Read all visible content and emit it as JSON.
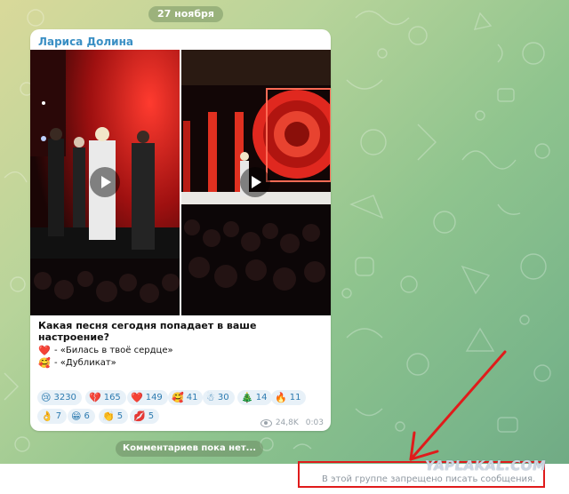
{
  "chat": {
    "date_label": "27 ноября"
  },
  "post": {
    "author": "Лариса Долина",
    "question": "Какая песня сегодня попадает в ваше настроение?",
    "options": [
      {
        "icon": "red-heart-emoji",
        "emoji": "❤️",
        "text": "- «Билась в твоё сердце»"
      },
      {
        "icon": "smiling-face-with-hearts-emoji",
        "emoji": "🥰",
        "text": "- «Дубликат»"
      }
    ],
    "reactions": [
      {
        "icon": "sad-face-emoji",
        "emoji": "😢",
        "count": "3230"
      },
      {
        "icon": "broken-heart-emoji",
        "emoji": "💔",
        "count": "165"
      },
      {
        "icon": "red-heart-emoji",
        "emoji": "❤️",
        "count": "149"
      },
      {
        "icon": "smiling-face-with-hearts-emoji",
        "emoji": "🥰",
        "count": "41"
      },
      {
        "icon": "snowman-emoji",
        "emoji": "☃",
        "count": "30"
      },
      {
        "icon": "christmas-tree-emoji",
        "emoji": "🎄",
        "count": "14"
      },
      {
        "icon": "fire-emoji",
        "emoji": "🔥",
        "count": "11"
      },
      {
        "icon": "ok-hand-emoji",
        "emoji": "👌",
        "count": "7"
      },
      {
        "icon": "grinning-face-emoji",
        "emoji": "😁",
        "count": "6"
      },
      {
        "icon": "clapping-hands-emoji",
        "emoji": "👏",
        "count": "5"
      },
      {
        "icon": "kiss-lips-emoji",
        "emoji": "💋",
        "count": "5"
      }
    ],
    "views": "24,8K",
    "time": "0:03"
  },
  "comments_label": "Комментариев пока нет...",
  "input": {
    "readonly_text": "В этой группе запрещено писать сообщения."
  },
  "watermark": "YAPLAKAL.COM",
  "colors": {
    "annotation_red": "#e01b1b",
    "author_blue": "#3a8fc4",
    "reaction_bg": "#e8f1f8"
  }
}
